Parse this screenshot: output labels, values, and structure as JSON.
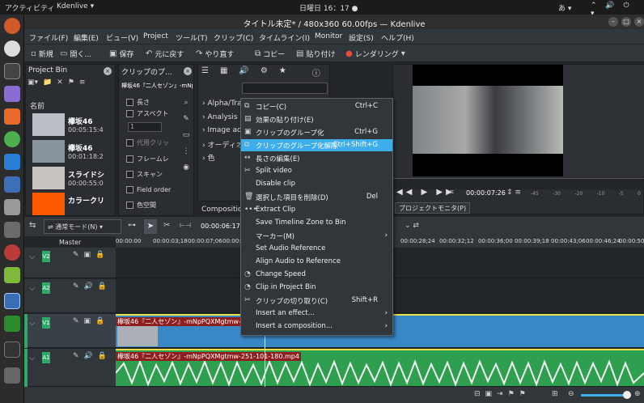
{
  "topbar": {
    "activities": "アクティビティ",
    "app": "Kdenlive ▾",
    "clock": "日曜日 16：17 ●",
    "ime": "あ ▾",
    "tray": "⌃ 🔊 ⏻ ▾"
  },
  "window": {
    "title": "タイトル未定* / 480x360 60.00fps — Kdenlive"
  },
  "menubar": [
    "ファイル(F)",
    "編集(E)",
    "ビュー(V)",
    "Project",
    "ツール(T)",
    "クリップ(C)",
    "タイムライン(I)",
    "Monitor",
    "設定(S)",
    "ヘルプ(H)"
  ],
  "toolbar": {
    "new": "新規",
    "open": "開く...",
    "save": "保存",
    "undo": "元に戻す",
    "redo": "やり直す",
    "copy": "コピー",
    "paste": "貼り付け",
    "render": "レンダリング"
  },
  "project_bin": {
    "title": "Project Bin",
    "column": "名前",
    "items": [
      {
        "name": "欅坂46",
        "duration": "00:05:15:4"
      },
      {
        "name": "欅坂46",
        "duration": "00:01:18:2"
      },
      {
        "name": "スライドシ",
        "duration": "00:00:55:0"
      },
      {
        "name": "カラークリ",
        "duration": ""
      }
    ]
  },
  "clip_props": {
    "title": "クリップのプ...",
    "clip": "欅坂46『二人セゾン』-mNp",
    "rows": [
      "長さ",
      "アスペクト",
      "1",
      "代用クリッ",
      "フレームレ",
      "スキャン",
      "Field order",
      "色空間"
    ]
  },
  "effects": {
    "items": [
      "Alpha/Tra",
      "Analysis a",
      "Image adj",
      "オーディオ",
      "色"
    ]
  },
  "composition_tab": "Compositions",
  "context_menu": {
    "items": [
      {
        "icon": "⧉",
        "label": "コピー(C)",
        "shortcut": "Ctrl+C"
      },
      {
        "icon": "▤",
        "label": "効果の貼り付け(E)",
        "shortcut": ""
      },
      {
        "icon": "▣",
        "label": "クリップのグループ化",
        "shortcut": "Ctrl+G"
      },
      {
        "icon": "⧉",
        "label": "クリップのグループ化解除",
        "shortcut": "Ctrl+Shift+G"
      },
      {
        "icon": "↔",
        "label": "長さの編集(E)",
        "shortcut": ""
      },
      {
        "icon": "✂",
        "label": "Split video",
        "shortcut": ""
      },
      {
        "icon": "",
        "label": "Disable clip",
        "shortcut": ""
      },
      {
        "icon": "🗑",
        "label": "選択した項目を削除(D)",
        "shortcut": "Del"
      },
      {
        "icon": "•••",
        "label": "Extract Clip",
        "shortcut": ""
      },
      {
        "icon": "",
        "label": "Save Timeline Zone to Bin",
        "shortcut": ""
      },
      {
        "icon": "",
        "label": "マーカー(M)",
        "shortcut": "",
        "submenu": "›"
      },
      {
        "icon": "",
        "label": "Set Audio Reference",
        "shortcut": ""
      },
      {
        "icon": "",
        "label": "Align Audio to Reference",
        "shortcut": ""
      },
      {
        "icon": "◔",
        "label": "Change Speed",
        "shortcut": ""
      },
      {
        "icon": "◔",
        "label": "Clip in Project Bin",
        "shortcut": ""
      },
      {
        "icon": "✂",
        "label": "クリップの切り取り(C)",
        "shortcut": "Shift+R"
      },
      {
        "icon": "",
        "label": "Insert an effect...",
        "shortcut": "",
        "submenu": "›"
      },
      {
        "icon": "",
        "label": "Insert a composition...",
        "shortcut": "",
        "submenu": "›"
      }
    ]
  },
  "monitor": {
    "timecode": "00:00:07:26",
    "tab": "プロジェクトモニタ(P)",
    "meter_labels": [
      "-45",
      "-30",
      "-20",
      "-10",
      "-5",
      "0"
    ]
  },
  "timeline": {
    "mode": "通常モード(N)",
    "timecode": "00:00:06:17",
    "master": "Master",
    "ruler": [
      "00:00:00",
      "00:00:03;18",
      "00:00:07;06",
      "00:00:10;24",
      "00:00:28;24",
      "00:00:32;12",
      "00:00:36;00",
      "00:00:39;18",
      "00:00:43;06",
      "00:00:46;24",
      "00:00:50;12"
    ],
    "tracks": [
      "V2",
      "A2",
      "V1",
      "A1"
    ],
    "clip_v1": "欅坂46『二人セゾン』-mNpPQXMgtmw-251-101-180.mp4",
    "clip_a1": "欅坂46『二人セゾン』-mNpPQXMgtmw-251-101-180.mp4"
  },
  "colors": {
    "accent": "#3daee9",
    "video_clip": "#3a87c8",
    "audio_clip": "#2e9f4e",
    "track_tag": "#2fa86a"
  }
}
